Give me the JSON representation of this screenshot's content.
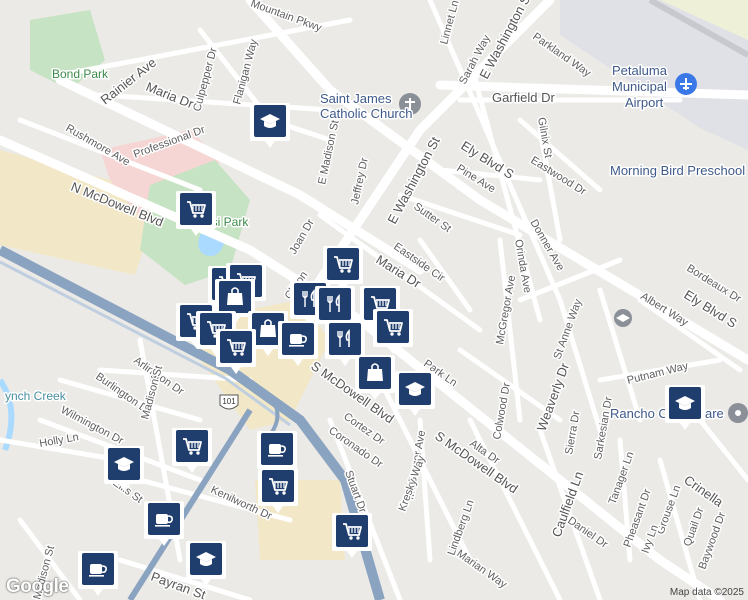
{
  "streets": [
    {
      "id": "mountain-pkwy",
      "label": "Mountain Pkwy"
    },
    {
      "id": "rainier-ave",
      "label": "Rainier Ave"
    },
    {
      "id": "maria-dr",
      "label": "Maria Dr"
    },
    {
      "id": "culpepper-dr",
      "label": "Culpepper Dr"
    },
    {
      "id": "flanigan-way",
      "label": "Flanigan Way"
    },
    {
      "id": "rushmore-ave",
      "label": "Rushmore Ave"
    },
    {
      "id": "professional-dr",
      "label": "Professional Dr"
    },
    {
      "id": "e-madison-st",
      "label": "E Madison St"
    },
    {
      "id": "jeffrey-dr",
      "label": "Jeffrey Dr"
    },
    {
      "id": "n-mcdowell-blvd",
      "label": "N McDowell Blvd"
    },
    {
      "id": "joan-dr",
      "label": "Joan Dr"
    },
    {
      "id": "maria-dr-2",
      "label": "Maria Dr"
    },
    {
      "id": "eastside-cir",
      "label": "Eastside Cir"
    },
    {
      "id": "sutter-st",
      "label": "Sutter St"
    },
    {
      "id": "e-washington-st",
      "label": "E Washington St"
    },
    {
      "id": "e-washington-st-2",
      "label": "E Washington St"
    },
    {
      "id": "pine-ave",
      "label": "Pine Ave"
    },
    {
      "id": "ely-blvd-s",
      "label": "Ely Blvd S"
    },
    {
      "id": "ely-blvd-s-2",
      "label": "Ely Blvd S"
    },
    {
      "id": "garfield-dr",
      "label": "Garfield Dr"
    },
    {
      "id": "sarah-way",
      "label": "Sarah Way"
    },
    {
      "id": "parkland-way",
      "label": "Parkland Way"
    },
    {
      "id": "linnet-ln",
      "label": "Linnet Ln"
    },
    {
      "id": "gilnix-st",
      "label": "Gilnix St"
    },
    {
      "id": "eastwood-dr",
      "label": "Eastwood Dr"
    },
    {
      "id": "donner-ave",
      "label": "Donner Ave"
    },
    {
      "id": "orinda-ave",
      "label": "Orinda Ave"
    },
    {
      "id": "mcgregor-ave",
      "label": "McGregor Ave"
    },
    {
      "id": "mcgregor-ave-2",
      "label": "McGregor Ave"
    },
    {
      "id": "bordeaux-dr",
      "label": "Bordeaux Dr"
    },
    {
      "id": "albert-way",
      "label": "Albert Way"
    },
    {
      "id": "st-anne-way",
      "label": "St Anne Way"
    },
    {
      "id": "putnam-way",
      "label": "Putnam Way"
    },
    {
      "id": "park-ln",
      "label": "Park Ln"
    },
    {
      "id": "weaverly-dr",
      "label": "Weaverly Dr"
    },
    {
      "id": "colwood-dr",
      "label": "Colwood Dr"
    },
    {
      "id": "sierra-dr",
      "label": "Sierra Dr"
    },
    {
      "id": "sarkesian-dr",
      "label": "Sarkesian Dr"
    },
    {
      "id": "alta-dr",
      "label": "Alta Dr"
    },
    {
      "id": "s-mcdowell-blvd",
      "label": "S McDowell Blvd"
    },
    {
      "id": "s-mcdowell-blvd-2",
      "label": "S McDowell Blvd"
    },
    {
      "id": "cortez-dr",
      "label": "Cortez Dr"
    },
    {
      "id": "coronado-dr",
      "label": "Coronado Dr"
    },
    {
      "id": "kresky-way",
      "label": "Kresky Way"
    },
    {
      "id": "stuart-dr",
      "label": "Stuart Dr"
    },
    {
      "id": "lindberg-ln",
      "label": "Lindberg Ln"
    },
    {
      "id": "marian-way",
      "label": "Marian Way"
    },
    {
      "id": "caulfield-ln",
      "label": "Caulfield Ln"
    },
    {
      "id": "daniel-dr",
      "label": "Daniel Dr"
    },
    {
      "id": "tanager-ln",
      "label": "Tanager Ln"
    },
    {
      "id": "pheasant-dr",
      "label": "Pheasant Dr"
    },
    {
      "id": "grouse-ln",
      "label": "Grouse Ln"
    },
    {
      "id": "ivy-ln",
      "label": "Ivy Ln"
    },
    {
      "id": "quail-dr",
      "label": "Quail Dr"
    },
    {
      "id": "baywood-dr",
      "label": "Baywood Dr"
    },
    {
      "id": "crinella",
      "label": "Crinella"
    },
    {
      "id": "arlington-dr",
      "label": "Arlington Dr"
    },
    {
      "id": "burlington-dr",
      "label": "Burlington Dr"
    },
    {
      "id": "madison-st",
      "label": "Madison St"
    },
    {
      "id": "madison-st-2",
      "label": "Madison St"
    },
    {
      "id": "wilmington-dr",
      "label": "Wilmington Dr"
    },
    {
      "id": "holly-ln",
      "label": "Holly Ln"
    },
    {
      "id": "ellis-st",
      "label": "Ellis St"
    },
    {
      "id": "kenilworth-dr",
      "label": "Kenilworth Dr"
    },
    {
      "id": "payran-st",
      "label": "Payran St"
    },
    {
      "id": "clifton-ct",
      "label": "Clifton"
    },
    {
      "id": "hwy-101",
      "label": "101"
    }
  ],
  "places": {
    "bond_park": "Bond Park",
    "lucchesi_park": "esi Park",
    "church_line1": "Saint James",
    "church_line2": "Catholic Church",
    "airport_line1": "Petaluma",
    "airport_line2": "Municipal",
    "airport_line3": "Airport",
    "preschool": "Morning Bird Preschool",
    "rancho": "Rancho Co",
    "rancho_tail": "are",
    "creek": "ynch Creek"
  },
  "markers": [
    {
      "type": "school-icon"
    },
    {
      "type": "shopping-cart-icon"
    },
    {
      "type": "shopping-cart-icon"
    },
    {
      "type": "shopping-cart-icon"
    },
    {
      "type": "shopping-cart-icon"
    },
    {
      "type": "shopping-bag-icon"
    },
    {
      "type": "restaurant-icon"
    },
    {
      "type": "restaurant-icon"
    },
    {
      "type": "shopping-cart-icon"
    },
    {
      "type": "shopping-cart-icon"
    },
    {
      "type": "shopping-bag-icon"
    },
    {
      "type": "cafe-icon"
    },
    {
      "type": "shopping-cart-icon"
    },
    {
      "type": "restaurant-icon"
    },
    {
      "type": "shopping-cart-icon"
    },
    {
      "type": "shopping-bag-icon"
    },
    {
      "type": "school-icon"
    },
    {
      "type": "school-icon"
    },
    {
      "type": "shopping-cart-icon"
    },
    {
      "type": "school-icon"
    },
    {
      "type": "cafe-icon"
    },
    {
      "type": "shopping-cart-icon"
    },
    {
      "type": "cafe-icon"
    },
    {
      "type": "school-icon"
    },
    {
      "type": "cafe-icon"
    },
    {
      "type": "shopping-cart-icon"
    },
    {
      "type": "shopping-cart-icon"
    }
  ],
  "footer": {
    "logo": "Google",
    "attribution": "Map data ©2025"
  },
  "colors": {
    "background": "#ebeae6",
    "road": "#ffffff",
    "highway": "#8aa3c0",
    "park": "#c6e3c3",
    "water": "#aadaff",
    "commercial": "#f2e8c8",
    "hospital": "#f6d6d4",
    "airport": "#dfe1e6",
    "marker": "#1f3e6e"
  }
}
